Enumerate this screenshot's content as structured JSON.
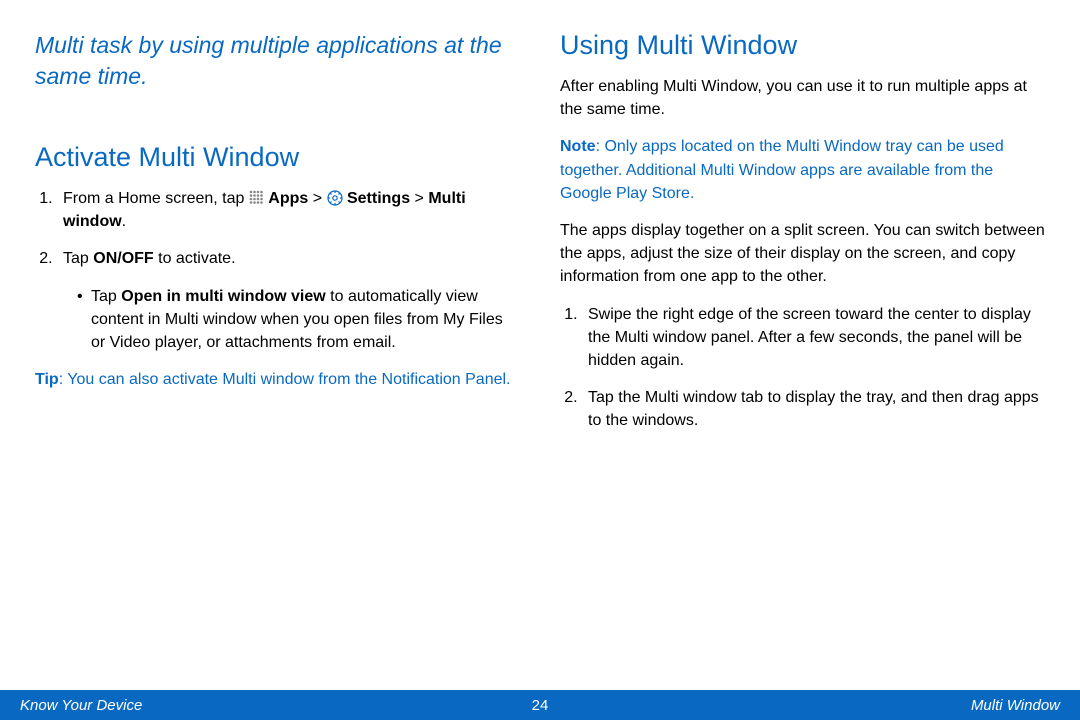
{
  "left": {
    "intro": "Multi task by using multiple applications at the same time.",
    "heading": "Activate Multi Window",
    "step1_pre": "From a Home screen, tap ",
    "step1_apps": "Apps",
    "step1_gt1": " > ",
    "step1_settings": "Settings",
    "step1_gt2": " > ",
    "step1_multiwindow": "Multi window",
    "step1_end": ".",
    "step2_pre": "Tap ",
    "step2_onoff": "ON/OFF",
    "step2_post": " to activate.",
    "bullet_pre": "Tap ",
    "bullet_bold": "Open in multi window view",
    "bullet_post": " to automatically view content in Multi window when you open files from My Files or Video player, or attachments from email.",
    "tip_label": "Tip",
    "tip_text": ": You can also activate Multi window from the Notification Panel."
  },
  "right": {
    "heading": "Using Multi Window",
    "para1": "After enabling Multi Window, you can use it to run multiple apps at the same time.",
    "note_label": "Note",
    "note_text": ": Only apps located on the Multi Window tray can be used together. Additional Multi Window apps are available from the Google Play Store.",
    "para2": "The apps display together on a split screen. You can switch between the apps, adjust the size of their display on the screen, and copy information from one app to the other.",
    "step1": "Swipe the right edge of the screen toward the center to display the Multi window panel. After a few seconds, the panel will be hidden again.",
    "step2": "Tap the Multi window tab to display the tray, and then drag apps to the windows."
  },
  "footer": {
    "left": "Know Your Device",
    "page": "24",
    "right": "Multi Window"
  }
}
